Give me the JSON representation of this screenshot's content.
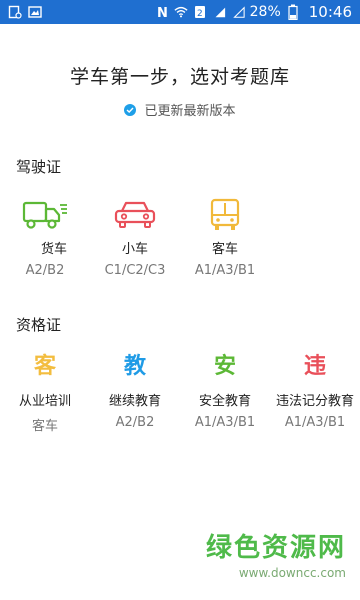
{
  "status_bar": {
    "battery": "28%",
    "time": "10:46"
  },
  "header": {
    "headline": "学车第一步，选对考题库",
    "updated": "已更新最新版本"
  },
  "driving": {
    "title": "驾驶证",
    "items": [
      {
        "label": "货车",
        "sub": "A2/B2",
        "color": "#5cb836",
        "icon": "truck-icon"
      },
      {
        "label": "小车",
        "sub": "C1/C2/C3",
        "color": "#e9505a",
        "icon": "car-icon"
      },
      {
        "label": "客车",
        "sub": "A1/A3/B1",
        "color": "#f1b93a",
        "icon": "bus-icon"
      }
    ]
  },
  "qualification": {
    "title": "资格证",
    "items": [
      {
        "glyph": "客",
        "label": "从业培训",
        "sub": "客车",
        "color": "#f3bd3f"
      },
      {
        "glyph": "教",
        "label": "继续教育",
        "sub": "A2/B2",
        "color": "#1f9be6"
      },
      {
        "glyph": "安",
        "label": "安全教育",
        "sub": "A1/A3/B1",
        "color": "#5cb836"
      },
      {
        "glyph": "违",
        "label": "违法记分教育",
        "sub": "A1/A3/B1",
        "color": "#e9505a"
      }
    ]
  },
  "watermark": {
    "main": "绿色资源网",
    "url": "www.downcc.com"
  }
}
